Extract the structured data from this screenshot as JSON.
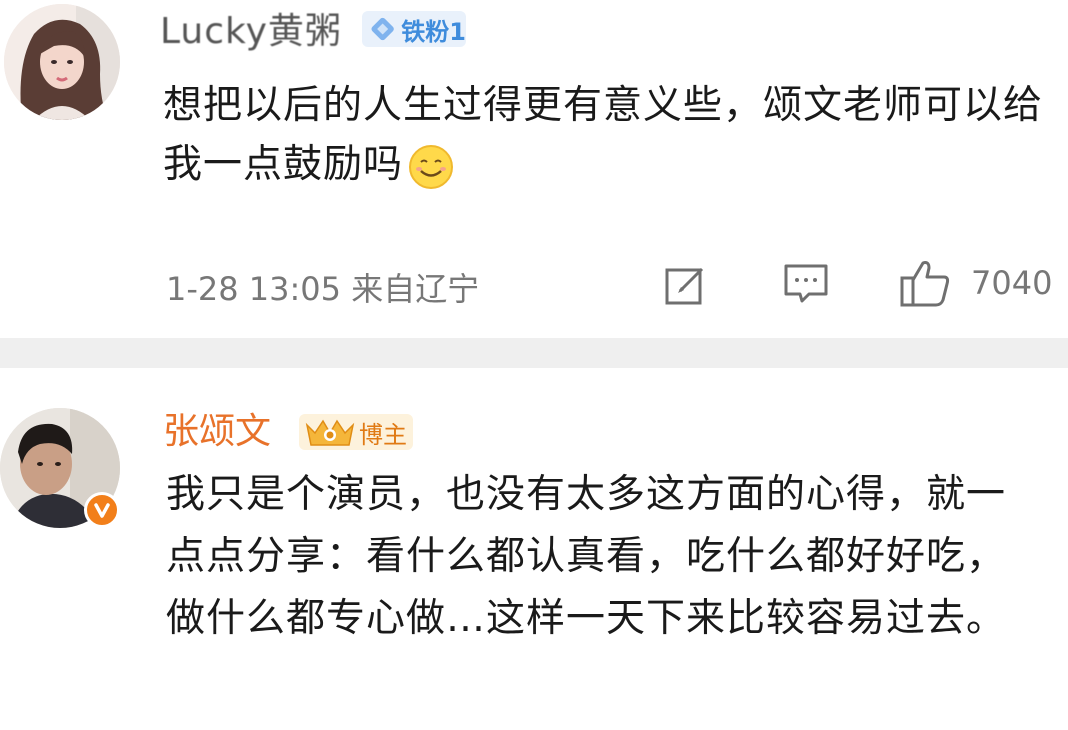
{
  "comments": [
    {
      "username": "Lucky黄粥",
      "badge": "铁粉1",
      "text": "想把以后的人生过得更有意义些，颂文老师可以给我一点鼓励吗",
      "emoji": "smile-emoji",
      "time": "1-28 13:05 来自辽宁",
      "likes": "7040",
      "icons": [
        "edit-icon",
        "reply-icon",
        "thumbs-up-icon"
      ]
    },
    {
      "username": "张颂文",
      "badge": "博主",
      "text": "我只是个演员，也没有太多这方面的心得，就一点点分享：看什么都认真看，吃什么都好好吃，做什么都专心做…这样一天下来比较容易过去。",
      "verified_icon": "verified-v-icon"
    }
  ],
  "colors": {
    "author_name": "#e8722a",
    "fan_badge_bg": "#e9f1fb",
    "fan_badge_text": "#3f8cdc",
    "blogger_badge_bg": "#fdf2dc",
    "divider": "#efefef",
    "meta_text": "#777777"
  }
}
